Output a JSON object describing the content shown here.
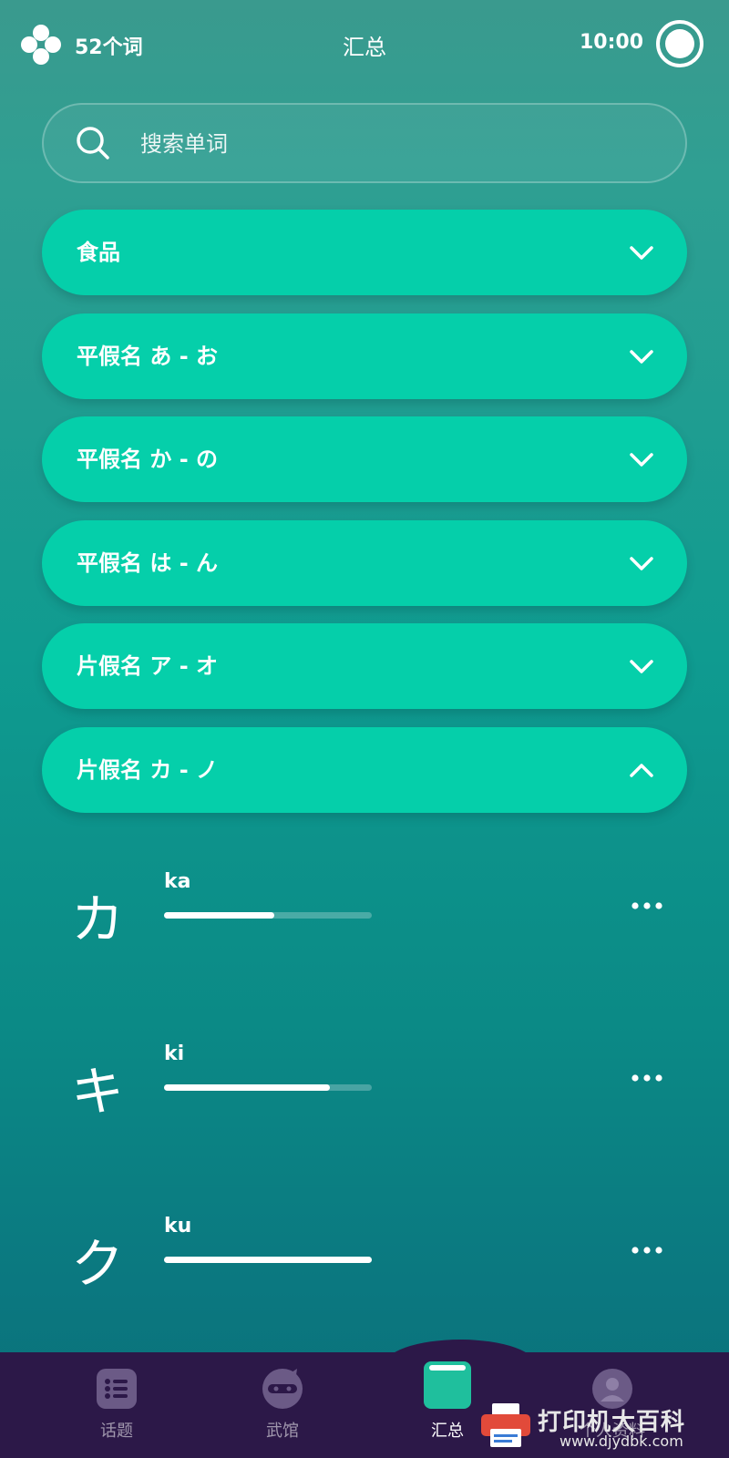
{
  "header": {
    "word_count": "52个词",
    "title": "汇总",
    "time": "10:00"
  },
  "search": {
    "placeholder": "搜索单词"
  },
  "categories": [
    {
      "label": "食品",
      "expanded": false
    },
    {
      "label": "平假名 あ - お",
      "expanded": false
    },
    {
      "label": "平假名 か - の",
      "expanded": false
    },
    {
      "label": "平假名 は - ん",
      "expanded": false
    },
    {
      "label": "片假名 ア - オ",
      "expanded": false
    },
    {
      "label": "片假名 カ - ノ",
      "expanded": true
    }
  ],
  "items": [
    {
      "kana": "カ",
      "romaji": "ka",
      "progress": 0.53
    },
    {
      "kana": "キ",
      "romaji": "ki",
      "progress": 0.8
    },
    {
      "kana": "ク",
      "romaji": "ku",
      "progress": 1.0
    }
  ],
  "nav": [
    {
      "label": "话题",
      "icon": "list-icon",
      "active": false
    },
    {
      "label": "武馆",
      "icon": "ninja-icon",
      "active": false
    },
    {
      "label": "汇总",
      "icon": "book-icon",
      "active": true
    },
    {
      "label": "个人资料",
      "icon": "profile-icon",
      "active": false
    }
  ],
  "watermark": {
    "text": "打印机大百科",
    "url": "www.djydbk.com"
  },
  "colors": {
    "accent": "#05cfaa",
    "nav_bg": "#2c1848"
  }
}
